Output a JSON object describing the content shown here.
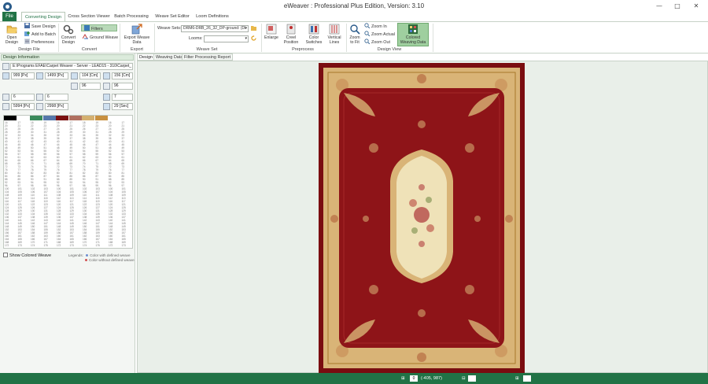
{
  "window": {
    "title": "eWeaver : Professional Plus Edition, Version: 3.10",
    "minimize": "—",
    "maximize": "□",
    "close": "✕"
  },
  "ribbon_tabs": {
    "file": "File",
    "tabs": [
      "Converting Design",
      "Cross Section Viewer",
      "Batch Processing",
      "Weave Set Editor",
      "Loom Definitions"
    ],
    "active_index": 0
  },
  "ribbon": {
    "design_file": {
      "open_design": "Open",
      "open_design_2": "Design",
      "save_design": "Save Design",
      "add_to_batch": "Add to Batch",
      "preferences": "Preferences",
      "label": "Design File"
    },
    "convert": {
      "convert_design": "Convert",
      "convert_design_2": "Design",
      "filters": "Filters",
      "ground_weave": "Ground Weave",
      "label": "Convert"
    },
    "export": {
      "export_weave": "Export Weave",
      "export_weave_2": "Data",
      "label": "Export"
    },
    "weave_set": {
      "weave_sets_label": "Weave Sets:",
      "weave_sets_value": "DRM6-DRB_26_32_DP-ground: (DI",
      "looms_label": "Looms:",
      "looms_value": "",
      "label": "Weave Set"
    },
    "preprocess": {
      "enlarge": "Enlarge",
      "creel_position": "Creel",
      "creel_position_2": "Position",
      "color_switches": "Color",
      "color_switches_2": "Switches",
      "vertical_lines": "Vertical",
      "vertical_lines_2": "Lines",
      "label": "Preprocess"
    },
    "design_view": {
      "zoom_to_fit": "Zoom",
      "zoom_to_fit_2": "to Fit",
      "zoom_in": "Zoom In",
      "zoom_actual": "Zoom Actual",
      "zoom_out": "Zoom Out",
      "colored_weaving": "Colored",
      "colored_weaving_2": "Weaving Data",
      "label": "Design View"
    }
  },
  "design_info": {
    "header": "Design Information",
    "path": "E:\\Programs EFAE\\Carpet Weaver - Server - LEAD15 - 310\\Carpet_",
    "width_px": "999 [Px]",
    "height_px": "1499 [Px]",
    "width_cm": "104 [Cm]",
    "height_cm": "156 [Cm]",
    "dpi_x": "96",
    "dpi_y": "96",
    "colors_a": "6",
    "colors_b": "6",
    "count_c": "7",
    "total_x": "5994 [Px]",
    "total_y": "2998 [Px]",
    "time": "29 [Sec]"
  },
  "weave_grid": {
    "swatches": [
      "#000000",
      "#ffffff",
      "#3a8a5a",
      "#5577aa",
      "#7a1010",
      "#b07060",
      "#d4b070",
      "#c89040"
    ],
    "rows": [
      [
        "16",
        "17",
        "18",
        "19",
        "16",
        "17",
        "18",
        "19",
        "16",
        "17"
      ],
      [
        "20",
        "21",
        "22",
        "23",
        "20",
        "21",
        "22",
        "23",
        "20",
        "21"
      ],
      [
        "24",
        "25",
        "26",
        "27",
        "24",
        "25",
        "26",
        "27",
        "24",
        "25"
      ],
      [
        "28",
        "29",
        "30",
        "31",
        "28",
        "29",
        "30",
        "31",
        "28",
        "29"
      ],
      [
        "32",
        "33",
        "34",
        "35",
        "32",
        "33",
        "34",
        "35",
        "32",
        "33"
      ],
      [
        "36",
        "37",
        "38",
        "39",
        "36",
        "37",
        "38",
        "39",
        "36",
        "37"
      ],
      [
        "40",
        "41",
        "42",
        "43",
        "40",
        "41",
        "42",
        "43",
        "40",
        "41"
      ],
      [
        "44",
        "45",
        "46",
        "47",
        "44",
        "45",
        "46",
        "47",
        "44",
        "45"
      ],
      [
        "48",
        "49",
        "50",
        "51",
        "48",
        "49",
        "50",
        "51",
        "48",
        "49"
      ],
      [
        "52",
        "53",
        "54",
        "55",
        "52",
        "53",
        "54",
        "55",
        "52",
        "53"
      ],
      [
        "56",
        "57",
        "58",
        "59",
        "56",
        "57",
        "58",
        "59",
        "56",
        "57"
      ],
      [
        "60",
        "61",
        "62",
        "63",
        "60",
        "61",
        "62",
        "63",
        "60",
        "61"
      ],
      [
        "64",
        "65",
        "66",
        "67",
        "64",
        "65",
        "66",
        "67",
        "64",
        "65"
      ],
      [
        "68",
        "69",
        "70",
        "71",
        "68",
        "69",
        "70",
        "71",
        "68",
        "69"
      ],
      [
        "72",
        "73",
        "74",
        "75",
        "72",
        "73",
        "74",
        "75",
        "72",
        "73"
      ],
      [
        "76",
        "77",
        "78",
        "79",
        "76",
        "77",
        "78",
        "79",
        "76",
        "77"
      ],
      [
        "80",
        "81",
        "82",
        "83",
        "80",
        "81",
        "82",
        "83",
        "80",
        "81"
      ],
      [
        "84",
        "85",
        "86",
        "87",
        "84",
        "85",
        "86",
        "87",
        "84",
        "85"
      ],
      [
        "88",
        "89",
        "90",
        "91",
        "88",
        "89",
        "90",
        "91",
        "88",
        "89"
      ],
      [
        "92",
        "93",
        "94",
        "95",
        "92",
        "93",
        "94",
        "95",
        "92",
        "93"
      ],
      [
        "96",
        "97",
        "98",
        "99",
        "96",
        "97",
        "98",
        "99",
        "96",
        "97"
      ],
      [
        "100",
        "101",
        "102",
        "103",
        "100",
        "101",
        "102",
        "103",
        "100",
        "101"
      ],
      [
        "104",
        "105",
        "106",
        "107",
        "104",
        "105",
        "106",
        "107",
        "104",
        "105"
      ],
      [
        "108",
        "109",
        "110",
        "111",
        "108",
        "109",
        "110",
        "111",
        "108",
        "109"
      ],
      [
        "112",
        "113",
        "114",
        "115",
        "112",
        "113",
        "114",
        "115",
        "112",
        "113"
      ],
      [
        "116",
        "117",
        "118",
        "119",
        "116",
        "117",
        "118",
        "119",
        "116",
        "117"
      ],
      [
        "120",
        "121",
        "122",
        "123",
        "120",
        "121",
        "122",
        "123",
        "120",
        "121"
      ],
      [
        "124",
        "125",
        "126",
        "127",
        "124",
        "125",
        "126",
        "127",
        "124",
        "125"
      ],
      [
        "128",
        "129",
        "130",
        "131",
        "128",
        "129",
        "130",
        "131",
        "128",
        "129"
      ],
      [
        "132",
        "133",
        "134",
        "135",
        "132",
        "133",
        "134",
        "135",
        "132",
        "133"
      ],
      [
        "136",
        "137",
        "138",
        "139",
        "136",
        "137",
        "138",
        "139",
        "136",
        "137"
      ],
      [
        "140",
        "141",
        "142",
        "143",
        "140",
        "141",
        "142",
        "143",
        "140",
        "141"
      ],
      [
        "144",
        "145",
        "146",
        "147",
        "144",
        "145",
        "146",
        "147",
        "144",
        "145"
      ],
      [
        "148",
        "149",
        "150",
        "151",
        "148",
        "149",
        "150",
        "151",
        "148",
        "149"
      ],
      [
        "152",
        "153",
        "154",
        "155",
        "152",
        "153",
        "154",
        "155",
        "152",
        "153"
      ],
      [
        "156",
        "157",
        "158",
        "159",
        "156",
        "157",
        "158",
        "159",
        "156",
        "157"
      ],
      [
        "160",
        "161",
        "162",
        "163",
        "160",
        "161",
        "162",
        "163",
        "160",
        "161"
      ],
      [
        "164",
        "165",
        "166",
        "167",
        "164",
        "165",
        "166",
        "167",
        "164",
        "165"
      ],
      [
        "168",
        "169",
        "170",
        "171",
        "168",
        "169",
        "170",
        "171",
        "168",
        "169"
      ],
      [
        "172",
        "173",
        "174",
        "175",
        "172",
        "173",
        "174",
        "175",
        "172",
        "173"
      ]
    ]
  },
  "left_footer": {
    "show_colored_weave": "Show Colored Weave",
    "legend_title": "Legends:",
    "legend_defined": "Color with defined weave",
    "legend_undefined": "Color without defined weave",
    "legend_defined_color": "#6f8fd0",
    "legend_undefined_color": "#d05050"
  },
  "doc_tabs": [
    "Design",
    "Weaving Data",
    "Filter Processing Report"
  ],
  "status_bar": {
    "scale": "0",
    "coords": "(-405, 987)"
  },
  "colors": {
    "accent": "#217346",
    "rug_field": "#8e1418",
    "rug_border": "#d9b477",
    "rug_outer": "#7a0d10",
    "rug_medallion": "#efe2b8"
  }
}
